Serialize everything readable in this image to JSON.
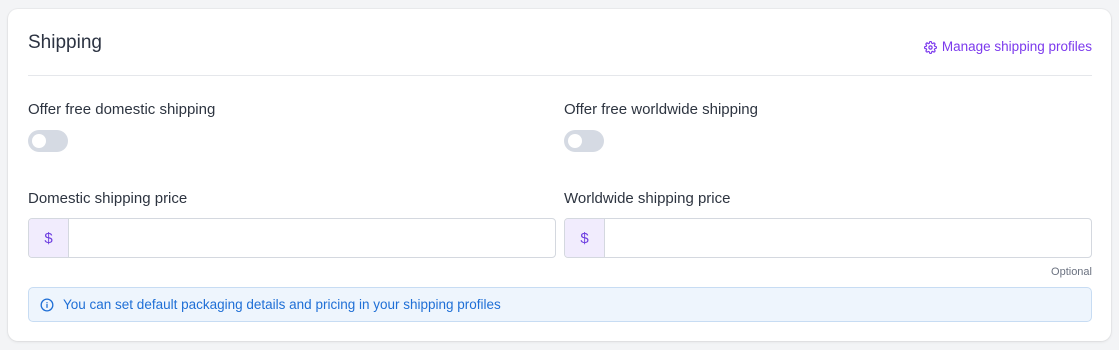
{
  "section": {
    "title": "Shipping",
    "manage_link": "Manage shipping profiles"
  },
  "domestic": {
    "free_label": "Offer free domestic shipping",
    "free_enabled": false,
    "price_label": "Domestic shipping price",
    "currency_symbol": "$",
    "price_value": ""
  },
  "worldwide": {
    "free_label": "Offer free worldwide shipping",
    "free_enabled": false,
    "price_label": "Worldwide shipping price",
    "currency_symbol": "$",
    "price_value": "",
    "optional_hint": "Optional"
  },
  "info": {
    "message": "You can set default packaging details and pricing in your shipping profiles",
    "icon": "info-icon"
  },
  "colors": {
    "accent": "#7c3aed",
    "info": "#1f6fd6",
    "toggle_off": "#d5dae3"
  }
}
